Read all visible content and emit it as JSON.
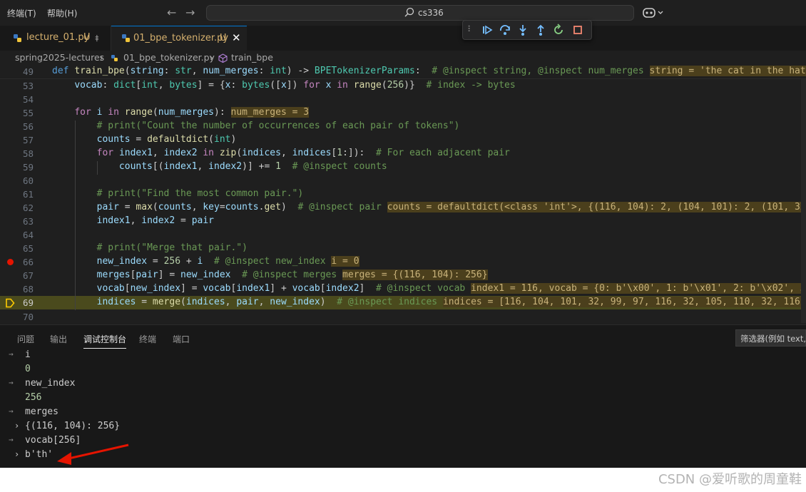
{
  "menu": {
    "terminal": "终端(T)",
    "help": "帮助(H)"
  },
  "search": {
    "label": "cs336"
  },
  "tabs": [
    {
      "label": "lecture_01.py",
      "status": "U"
    },
    {
      "label": "01_bpe_tokenizer.py",
      "status": "U"
    }
  ],
  "breadcrumb": {
    "folder": "spring2025-lectures",
    "file": "01_bpe_tokenizer.py",
    "symbol": "train_bpe"
  },
  "line_numbers": [
    "49",
    "53",
    "54",
    "55",
    "56",
    "57",
    "58",
    "59",
    "60",
    "61",
    "62",
    "63",
    "64",
    "65",
    "66",
    "67",
    "68",
    "69",
    "70"
  ],
  "panel": {
    "tabs": [
      "问题",
      "输出",
      "调试控制台",
      "终端",
      "端口"
    ],
    "filter_placeholder": "筛选器(例如 text, !exclude, \\escape)"
  },
  "console": [
    {
      "kind": "input",
      "text": "i"
    },
    {
      "kind": "value",
      "text": "0"
    },
    {
      "kind": "input",
      "text": "new_index"
    },
    {
      "kind": "value",
      "text": "256"
    },
    {
      "kind": "input",
      "text": "merges"
    },
    {
      "kind": "expandable",
      "text": "{(116, 104): 256}"
    },
    {
      "kind": "input",
      "text": "vocab[256]"
    },
    {
      "kind": "expandable",
      "text": "b'th'"
    }
  ],
  "watermark": "CSDN @爱听歌的周童鞋",
  "colors": {
    "accent": "#0078d4",
    "breakpoint": "#e51400",
    "current_line": "#4a4a1d",
    "annotation": "#e51400"
  }
}
